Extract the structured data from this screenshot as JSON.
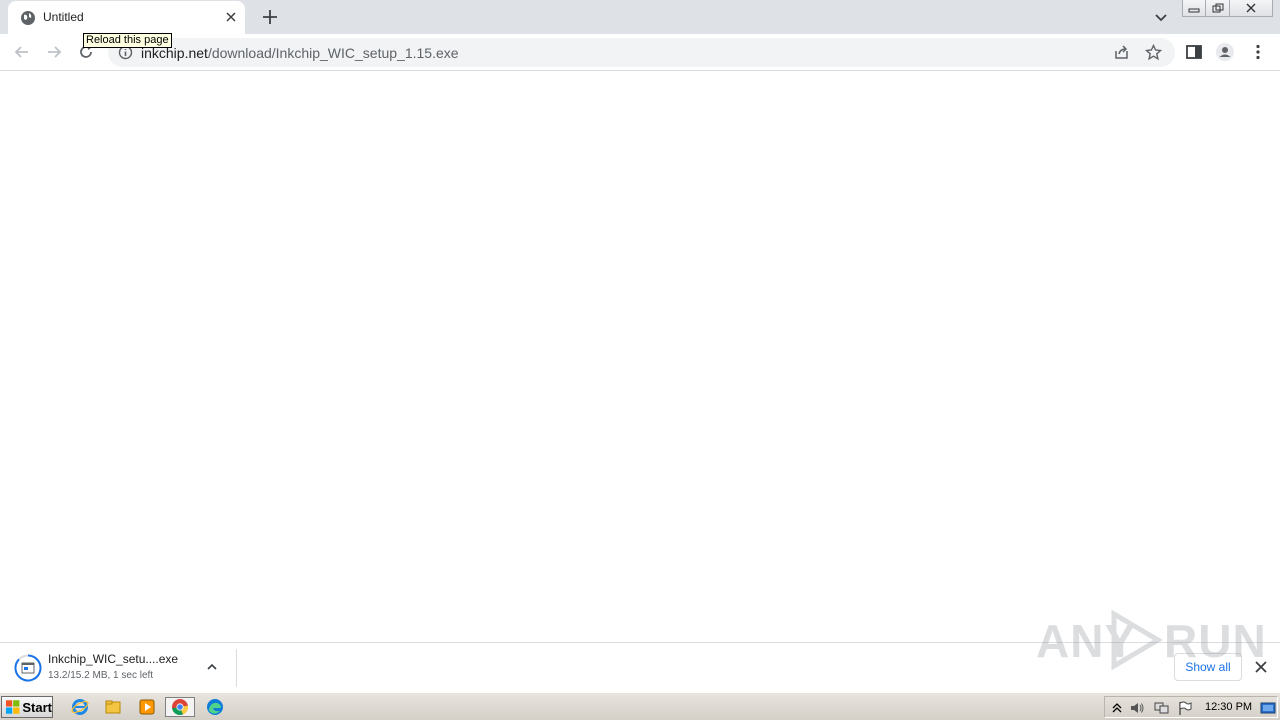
{
  "tab": {
    "title": "Untitled"
  },
  "omnibox": {
    "url_host": "inkchip.net",
    "url_path": "/download/Inkchip_WIC_setup_1.15.exe"
  },
  "tooltip": {
    "text": "Reload this page"
  },
  "download": {
    "filename": "Inkchip_WIC_setu....exe",
    "status": "13.2/15.2 MB, 1 sec left",
    "show_all_label": "Show all"
  },
  "watermark": {
    "text_left": "ANY",
    "text_right": "RUN"
  },
  "taskbar": {
    "start_label": "Start",
    "clock": "12:30 PM"
  },
  "colors": {
    "accent": "#1a73e8",
    "tabstrip": "#dee1e6",
    "omnibox": "#f1f3f4"
  }
}
